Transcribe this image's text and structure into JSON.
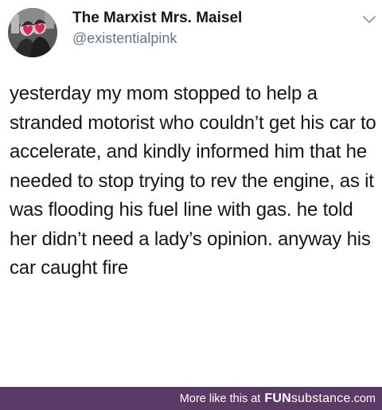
{
  "tweet": {
    "display_name": "The Marxist Mrs. Maisel",
    "handle": "@existentialpink",
    "text": "yesterday my mom stopped to help a stranded motorist who couldn’t get his car to accelerate, and kindly informed him that he needed to stop trying to rev the engine, as it was flooding his fuel line with gas. he told her didn’t need a lady’s opinion. anyway his car caught fire",
    "menu_icon": "chevron-down-icon"
  },
  "footer": {
    "more_label": "More like this at",
    "brand_bold": "FUN",
    "brand_rest": "substance",
    "brand_tld": ".com",
    "background_color": "#5c3a68"
  },
  "colors": {
    "text": "#14171a",
    "handle": "#657786"
  }
}
